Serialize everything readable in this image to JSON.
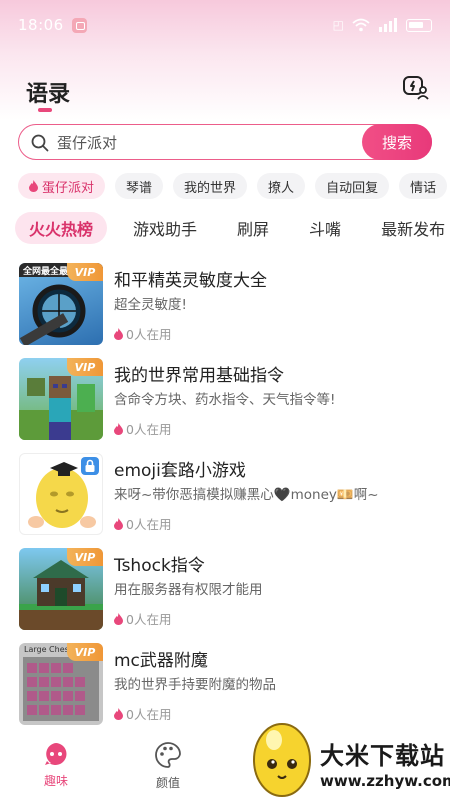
{
  "status_bar": {
    "time": "18:06",
    "wifi_label": "WiFi",
    "signal_label": "5G"
  },
  "header": {
    "title": "语录"
  },
  "search": {
    "value": "蛋仔派对",
    "button_label": "搜索"
  },
  "chips": [
    "蛋仔派对",
    "琴谱",
    "我的世界",
    "撩人",
    "自动回复",
    "情话"
  ],
  "tabs": [
    "火火热榜",
    "游戏助手",
    "刷屏",
    "斗嘴",
    "最新发布"
  ],
  "items": [
    {
      "title": "和平精英灵敏度大全",
      "desc": "超全灵敏度!",
      "usage": "0人在用",
      "badge": "VIP",
      "thumb_label": "全网最全最",
      "icon": "sniper-scope-icon"
    },
    {
      "title": "我的世界常用基础指令",
      "desc": "含命令方块、药水指令、天气指令等!",
      "usage": "0人在用",
      "badge": "VIP",
      "icon": "minecraft-steve-icon"
    },
    {
      "title": "emoji套路小游戏",
      "desc": "来呀~带你恶搞模拟赚黑心🖤money💴啊~",
      "usage": "0人在用",
      "badge": "lock",
      "icon": "emoji-moon-icon"
    },
    {
      "title": "Tshock指令",
      "desc": "用在服务器有权限才能用",
      "usage": "0人在用",
      "badge": "VIP",
      "icon": "terraria-house-icon"
    },
    {
      "title": "mc武器附魔",
      "desc": "我的世界手持要附魔的物品",
      "usage": "0人在用",
      "badge": "VIP",
      "thumb_label": "Large Chest",
      "icon": "minecraft-chest-icon"
    }
  ],
  "bottom_nav": [
    {
      "label": "趣味",
      "icon": "chat-bubble-icon",
      "active": true
    },
    {
      "label": "颜值",
      "icon": "palette-icon",
      "active": false
    }
  ],
  "watermark": {
    "title": "大米下载站",
    "url": "www.zzhyw.com"
  },
  "colors": {
    "accent": "#e8477b",
    "chip_active_bg": "#fde7ef",
    "vip": "#f09737"
  }
}
